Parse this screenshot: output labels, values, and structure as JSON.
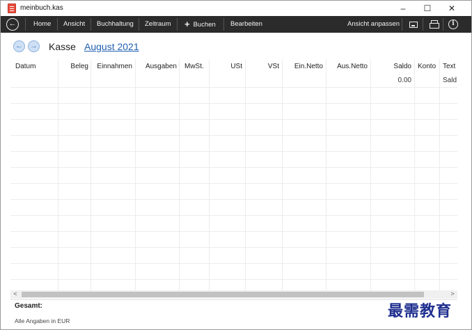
{
  "window": {
    "title": "meinbuch.kas",
    "minimize": "–",
    "maximize": "☐",
    "close": "✕"
  },
  "toolbar": {
    "back_icon": "arrow-left-circle-icon",
    "items": {
      "home": "Home",
      "ansicht": "Ansicht",
      "buchhaltung": "Buchhaltung",
      "zeitraum": "Zeitraum",
      "buchen": "Buchen",
      "bearbeiten": "Bearbeiten",
      "ansicht_anpassen": "Ansicht anpassen"
    },
    "buchen_icon": "+",
    "right_icons": [
      "screen-icon",
      "printer-icon",
      "info-icon"
    ]
  },
  "nav": {
    "prev_icon": "←",
    "next_icon": "→",
    "page_label": "Kasse",
    "period": "August 2021"
  },
  "table": {
    "headers": {
      "datum": "Datum",
      "beleg": "Beleg",
      "einnahmen": "Einnahmen",
      "ausgaben": "Ausgaben",
      "mwst": "MwSt.",
      "ust": "USt",
      "vst": "VSt",
      "ein_netto": "Ein.Netto",
      "aus_netto": "Aus.Netto",
      "saldo": "Saldo",
      "konto": "Konto",
      "text": "Text"
    },
    "first_row": {
      "saldo": "0.00",
      "text": "Sald"
    }
  },
  "scrollbar": {
    "left": "<",
    "right": ">"
  },
  "footer": {
    "total_label": "Gesamt:",
    "currency_note": "Alle Angaben in EUR"
  },
  "watermark": "最需教育",
  "colors": {
    "toolbar_bg": "#2b2b2b",
    "link": "#1f5fb0",
    "nav_arrow": "#cfe0f5",
    "watermark": "#1f2f8f"
  }
}
